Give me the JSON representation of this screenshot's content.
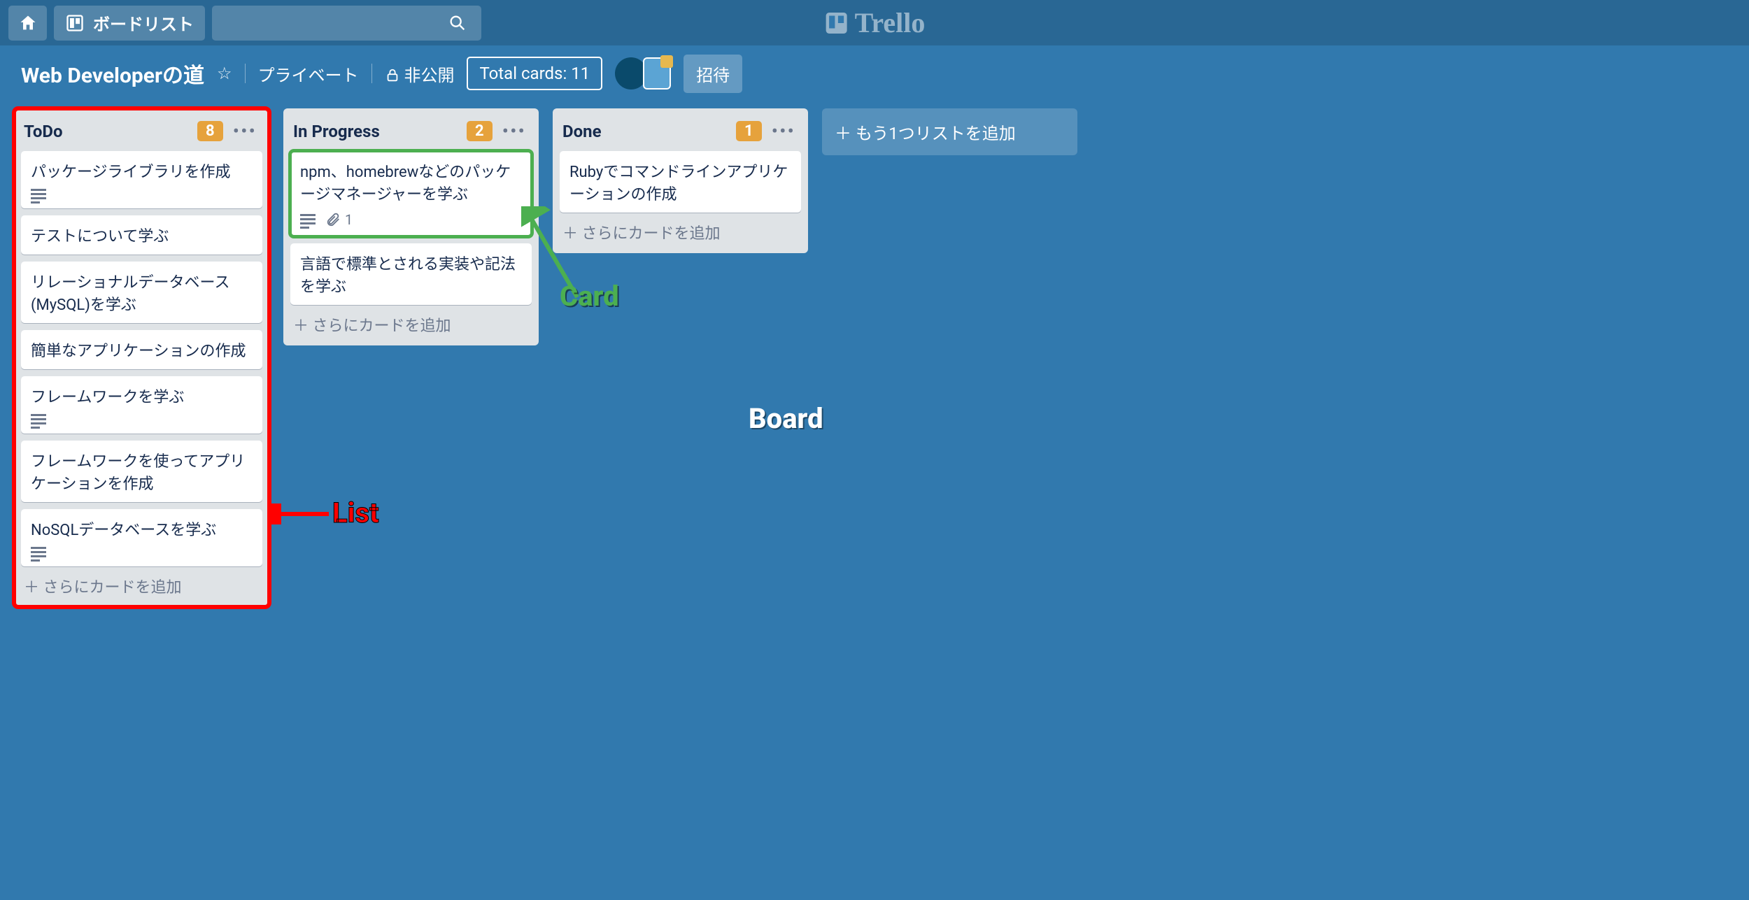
{
  "topbar": {
    "boards_label": "ボードリスト",
    "logo_text": "Trello"
  },
  "board_header": {
    "title": "Web Developerの道",
    "visibility_workspace": "プライベート",
    "visibility_public": "非公開",
    "total_cards": "Total cards: 11",
    "invite_label": "招待"
  },
  "lists": [
    {
      "title": "ToDo",
      "count": "8",
      "highlight": "red",
      "cards": [
        {
          "title": "パッケージライブラリを作成",
          "has_description": true
        },
        {
          "title": "テストについて学ぶ"
        },
        {
          "title": "リレーショナルデータベース(MySQL)を学ぶ"
        },
        {
          "title": "簡単なアプリケーションの作成"
        },
        {
          "title": "フレームワークを学ぶ",
          "has_description": true
        },
        {
          "title": "フレームワークを使ってアプリケーションを作成"
        },
        {
          "title": "NoSQLデータベースを学ぶ",
          "has_description": true
        }
      ],
      "add_card": "＋ さらにカードを追加"
    },
    {
      "title": "In Progress",
      "count": "2",
      "cards": [
        {
          "title": "npm、homebrewなどのパッケージマネージャーを学ぶ",
          "has_description": true,
          "attachments": "1",
          "highlight": "green"
        },
        {
          "title": "言語で標準とされる実装や記法を学ぶ"
        }
      ],
      "add_card": "＋ さらにカードを追加"
    },
    {
      "title": "Done",
      "count": "1",
      "cards": [
        {
          "title": "Rubyでコマンドラインアプリケーションの作成"
        }
      ],
      "add_card": "＋ さらにカードを追加"
    }
  ],
  "add_list_label": "＋ もう1つリストを追加",
  "annotations": {
    "card": "Card",
    "list": "List",
    "board": "Board"
  }
}
